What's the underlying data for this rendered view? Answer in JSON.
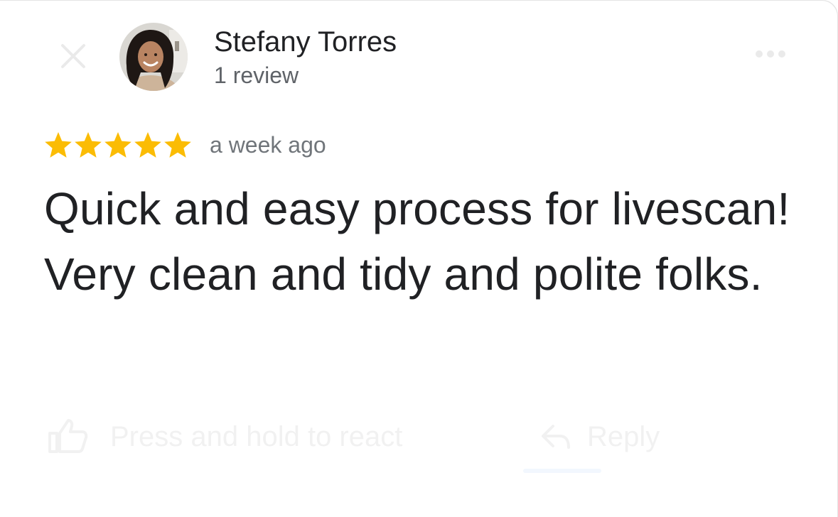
{
  "reviewer": {
    "name": "Stefany Torres",
    "review_count": "1 review"
  },
  "review": {
    "rating": 5,
    "max_rating": 5,
    "star_color": "#fbbc04",
    "timestamp": "a week ago",
    "text": "Quick and easy process for livescan! Very clean and tidy and polite folks."
  },
  "actions": {
    "like_hint": "Press and hold to react",
    "reply_label": "Reply"
  },
  "icons": {
    "close": "close-icon",
    "more": "more-vert-icon",
    "like": "thumb-up-icon",
    "reply": "reply-icon",
    "star": "star-icon"
  }
}
